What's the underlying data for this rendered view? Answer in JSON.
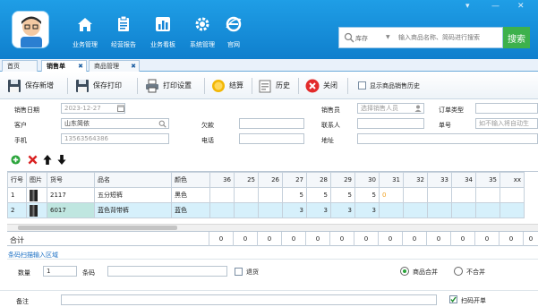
{
  "window": {
    "controls": [
      "▾",
      "—",
      "✕"
    ]
  },
  "nav": [
    {
      "label": "业务管理",
      "icon": "home-icon"
    },
    {
      "label": "经营报告",
      "icon": "clipboard-icon"
    },
    {
      "label": "业务看板",
      "icon": "bar-chart-icon"
    },
    {
      "label": "系统管理",
      "icon": "gear-icon"
    },
    {
      "label": "官网",
      "icon": "ie-browser-icon"
    }
  ],
  "search": {
    "category": "库存",
    "placeholder": "输入商品名称、简码进行搜索",
    "button": "搜索"
  },
  "tabs": [
    {
      "label": "首页"
    },
    {
      "label": "销售单"
    },
    {
      "label": "商品管理"
    }
  ],
  "toolbar": {
    "save_new": "保存新增",
    "save_print": "保存打印",
    "print_settings": "打印设置",
    "settle": "结算",
    "history": "历史",
    "close": "关闭",
    "show_history": "显示商品销售历史"
  },
  "form": {
    "sale_date_label": "销售日期",
    "sale_date_value": "2023-12-27",
    "customer_label": "客户",
    "customer_value": "山东简依",
    "phone_label": "手机",
    "phone_value": "13563564386",
    "debt_label": "欠款",
    "debt_value": "",
    "tel_label": "电话",
    "tel_value": "",
    "seller_label": "销售员",
    "seller_placeholder": "选择销售人员",
    "contact_label": "联系人",
    "contact_value": "",
    "address_label": "地址",
    "address_value": "",
    "order_type_label": "订单类型",
    "order_type_value": "",
    "order_no_label": "单号",
    "order_no_placeholder": "如不输入将自动生"
  },
  "grid": {
    "headers": [
      "行号",
      "图片",
      "货号",
      "品名",
      "颜色",
      "36",
      "25",
      "26",
      "27",
      "28",
      "29",
      "30",
      "31",
      "32",
      "33",
      "34",
      "35",
      "xx"
    ],
    "rows": [
      {
        "no": "1",
        "code": "2117",
        "name": "五分短裤",
        "color": "黑色",
        "sizes": [
          "",
          "",
          "",
          "5",
          "5",
          "5",
          "5",
          "0",
          "",
          "",
          "",
          "",
          "",
          ""
        ]
      },
      {
        "no": "2",
        "code": "6017",
        "name": "蓝色背带裤",
        "color": "蓝色",
        "sizes": [
          "",
          "",
          "",
          "3",
          "3",
          "3",
          "3",
          "",
          "",
          "",
          "",
          "",
          "",
          ""
        ]
      }
    ]
  },
  "totals": {
    "label": "合计",
    "values": [
      "0",
      "0",
      "0",
      "0",
      "0",
      "0",
      "0",
      "0",
      "0",
      "0",
      "0",
      "0",
      "0",
      "0"
    ]
  },
  "scan": {
    "section_title": "条码扫描输入区域",
    "qty_label": "数量",
    "qty_value": "1",
    "barcode_label": "条码",
    "barcode_value": "",
    "return_label": "退货",
    "merge_label": "商品合并",
    "no_merge_label": "不合并"
  },
  "bottom": {
    "remark_label": "备注",
    "remark_value": "",
    "scan_order_label": "扫码开单"
  },
  "colors": {
    "topbar": "#1f9ee6",
    "search_button": "#3db14c",
    "link_blue": "#1c70c4",
    "selected_row": "#d6f0fb"
  }
}
